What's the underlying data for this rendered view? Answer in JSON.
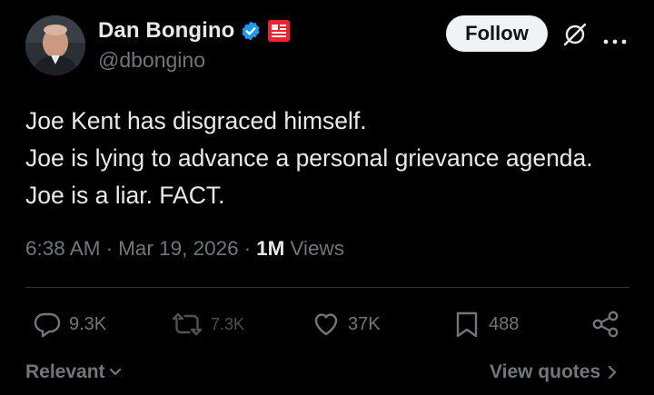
{
  "author": {
    "name": "Dan Bongino",
    "handle": "@dbongino",
    "verified_color": "#1d9bf0",
    "affiliate_color": "#f4212e"
  },
  "header": {
    "follow_label": "Follow",
    "icons": [
      "grok-icon",
      "more-icon"
    ]
  },
  "tweet": {
    "lines": [
      "Joe Kent has disgraced himself.",
      "Joe is lying to advance a personal grievance agenda.",
      "Joe is a liar. FACT."
    ]
  },
  "meta": {
    "time": "6:38 AM",
    "separator": "·",
    "date": "Mar 19, 2026",
    "views_count": "1M",
    "views_label": "Views"
  },
  "actions": {
    "replies": "9.3K",
    "reposts": "7.3K",
    "likes": "37K",
    "bookmarks": "488"
  },
  "footer": {
    "sort_label": "Relevant",
    "quotes_label": "View quotes"
  },
  "colors": {
    "background": "#000000",
    "text": "#e7e9ea",
    "secondary": "#71767b",
    "divider": "#2f3336",
    "follow_bg": "#eff3f4"
  }
}
